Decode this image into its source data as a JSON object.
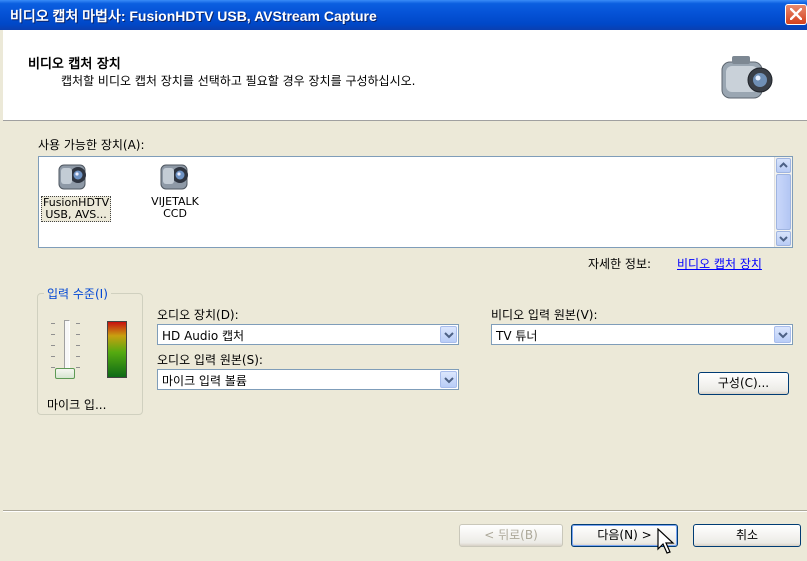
{
  "window": {
    "title": "비디오 캡처 마법사: FusionHDTV USB, AVStream Capture"
  },
  "header": {
    "title": "비디오 캡처 장치",
    "subtitle": "캡처할 비디오 캡처 장치를 선택하고 필요할 경우 장치를 구성하십시오."
  },
  "devices": {
    "label": "사용 가능한 장치(A):",
    "items": [
      {
        "name": "FusionHDTV USB, AVS..."
      },
      {
        "name": "VIJETALK CCD"
      }
    ]
  },
  "details": {
    "label": "자세한 정보:",
    "link": "비디오 캡처 장치"
  },
  "input_level": {
    "group_label": "입력 수준(I)",
    "caption": "마이크 입..."
  },
  "audio_device": {
    "label": "오디오 장치(D):",
    "value": "HD Audio 캡처"
  },
  "audio_source": {
    "label": "오디오 입력 원본(S):",
    "value": "마이크 입력 볼륨"
  },
  "video_source": {
    "label": "비디오 입력 원본(V):",
    "value": "TV 튜너"
  },
  "buttons": {
    "configure": "구성(C)...",
    "back": "< 뒤로(B)",
    "next": "다음(N) >",
    "cancel": "취소"
  },
  "colors": {
    "titlebar": "#0552d6",
    "face": "#ece9d8",
    "link": "#0000ff",
    "group_label": "#0046d5"
  }
}
